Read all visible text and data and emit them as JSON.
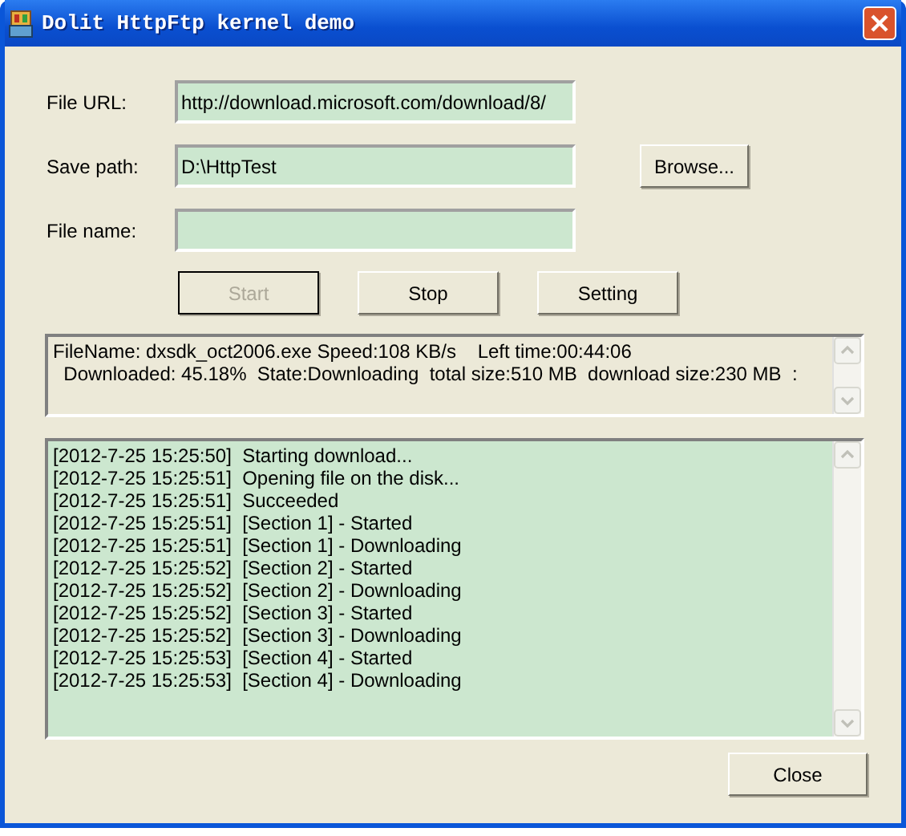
{
  "window": {
    "title": "Dolit HttpFtp kernel demo"
  },
  "fields": [
    {
      "label": "File URL:",
      "value": "http://download.microsoft.com/download/8/"
    },
    {
      "label": "Save path:",
      "value": "D:\\HttpTest",
      "button": "Browse..."
    },
    {
      "label": "File name:"
    }
  ],
  "buttons": [
    {
      "label": "Start",
      "disabled": true
    },
    {
      "label": "Stop",
      "disabled": false
    },
    {
      "label": "Setting",
      "disabled": false
    }
  ],
  "status": [
    "FileName: dxsdk_oct2006.exe Speed:108 KB/s    Left time:00:44:06",
    "  Downloaded: 45.18%  State:Downloading  total size:510 MB  download size:230 MB  :"
  ],
  "log": [
    "[2012-7-25 15:25:50]  Starting download...",
    "[2012-7-25 15:25:51]  Opening file on the disk...",
    "[2012-7-25 15:25:51]  Succeeded",
    "[2012-7-25 15:25:51]  [Section 1] - Started",
    "[2012-7-25 15:25:51]  [Section 1] - Downloading",
    "[2012-7-25 15:25:52]  [Section 2] - Started",
    "[2012-7-25 15:25:52]  [Section 2] - Downloading",
    "[2012-7-25 15:25:52]  [Section 3] - Started",
    "[2012-7-25 15:25:52]  [Section 3] - Downloading",
    "[2012-7-25 15:25:53]  [Section 4] - Started",
    "[2012-7-25 15:25:53]  [Section 4] - Downloading"
  ],
  "close_button": "Close"
}
